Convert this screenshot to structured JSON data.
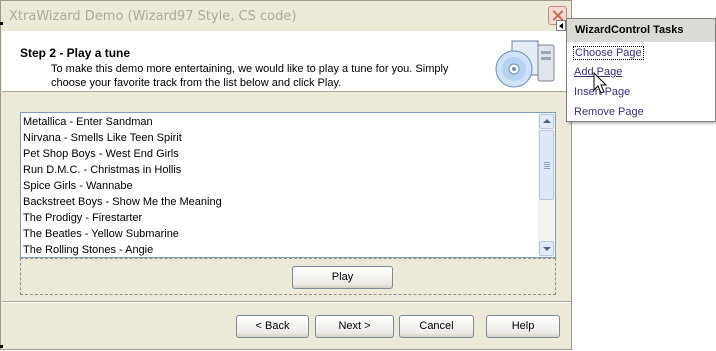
{
  "window": {
    "title": "XtraWizard Demo (Wizard97 Style, CS code)"
  },
  "header": {
    "step_title": "Step 2 - Play a tune",
    "description": "To make this demo more entertaining, we would like to play a tune for you. Simply choose your favorite track from the list below and click Play.",
    "icon": "cd-player-icon"
  },
  "tracks": [
    "Metallica - Enter Sandman",
    "Nirvana - Smells Like Teen Spirit",
    "Pet Shop Boys - West End Girls",
    "Run D.M.C. - Christmas in Hollis",
    "Spice Girls - Wannabe",
    "Backstreet Boys - Show Me the Meaning",
    "The Prodigy - Firestarter",
    "The Beatles - Yellow Submarine",
    "The Rolling Stones - Angie"
  ],
  "buttons": {
    "play": "Play",
    "back": "< Back",
    "next": "Next >",
    "cancel": "Cancel",
    "help": "Help"
  },
  "tasks_panel": {
    "title": "WizardControl Tasks",
    "items": [
      "Choose Page",
      "Add Page",
      "Insert Page",
      "Remove Page"
    ]
  },
  "colors": {
    "window_bg": "#ece9d8",
    "task_link": "#3c2e7c"
  }
}
